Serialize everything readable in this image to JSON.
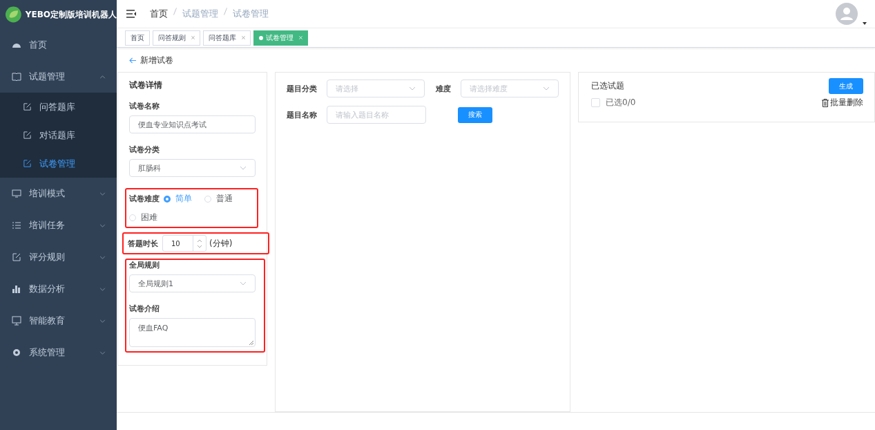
{
  "brand": {
    "title": "YEBO定制版培训机器人"
  },
  "sidebar": {
    "items": [
      {
        "label": "首页",
        "selected": false
      },
      {
        "label": "试题管理",
        "selected": false,
        "expanded": true,
        "children": [
          {
            "label": "问答题库",
            "selected": false
          },
          {
            "label": "对话题库",
            "selected": false
          },
          {
            "label": "试卷管理",
            "selected": true
          }
        ]
      },
      {
        "label": "培训模式",
        "selected": false,
        "expanded": false
      },
      {
        "label": "培训任务",
        "selected": false,
        "expanded": false
      },
      {
        "label": "评分规则",
        "selected": false,
        "expanded": false
      },
      {
        "label": "数据分析",
        "selected": false,
        "expanded": false
      },
      {
        "label": "智能教育",
        "selected": false,
        "expanded": false
      },
      {
        "label": "系统管理",
        "selected": false,
        "expanded": false
      }
    ]
  },
  "breadcrumb": [
    "首页",
    "试题管理",
    "试卷管理"
  ],
  "tags": [
    {
      "label": "首页",
      "selected": false,
      "closable": false
    },
    {
      "label": "问答规则",
      "selected": false,
      "closable": true
    },
    {
      "label": "问答题库",
      "selected": false,
      "closable": true
    },
    {
      "label": "试卷管理",
      "selected": true,
      "closable": true
    }
  ],
  "page_title": "新增试卷",
  "form": {
    "title": "试卷详情",
    "name_label": "试卷名称",
    "name_value": "便血专业知识点考试",
    "category_label": "试卷分类",
    "category_value": "肛肠科",
    "difficulty_label": "试卷难度",
    "difficulty_options": [
      {
        "label": "简单",
        "selected": true
      },
      {
        "label": "普通",
        "selected": false
      },
      {
        "label": "困难",
        "selected": false
      }
    ],
    "duration_label": "答题时长",
    "duration_value": "10",
    "duration_unit": "(分钟)",
    "rule_label": "全局规则",
    "rule_value": "全局规则1",
    "intro_label": "试卷介绍",
    "intro_value": "便血FAQ"
  },
  "filter": {
    "category_label": "题目分类",
    "category_placeholder": "请选择",
    "difficulty_label": "难度",
    "difficulty_placeholder": "请选择难度",
    "name_label": "题目名称",
    "name_placeholder": "请输入题目名称",
    "search_button": "搜索"
  },
  "selected_panel": {
    "title": "已选试题",
    "generate_button": "生成",
    "select_all": {
      "label": "已选0/0",
      "checked": false
    },
    "batch_delete": "批量删除"
  }
}
